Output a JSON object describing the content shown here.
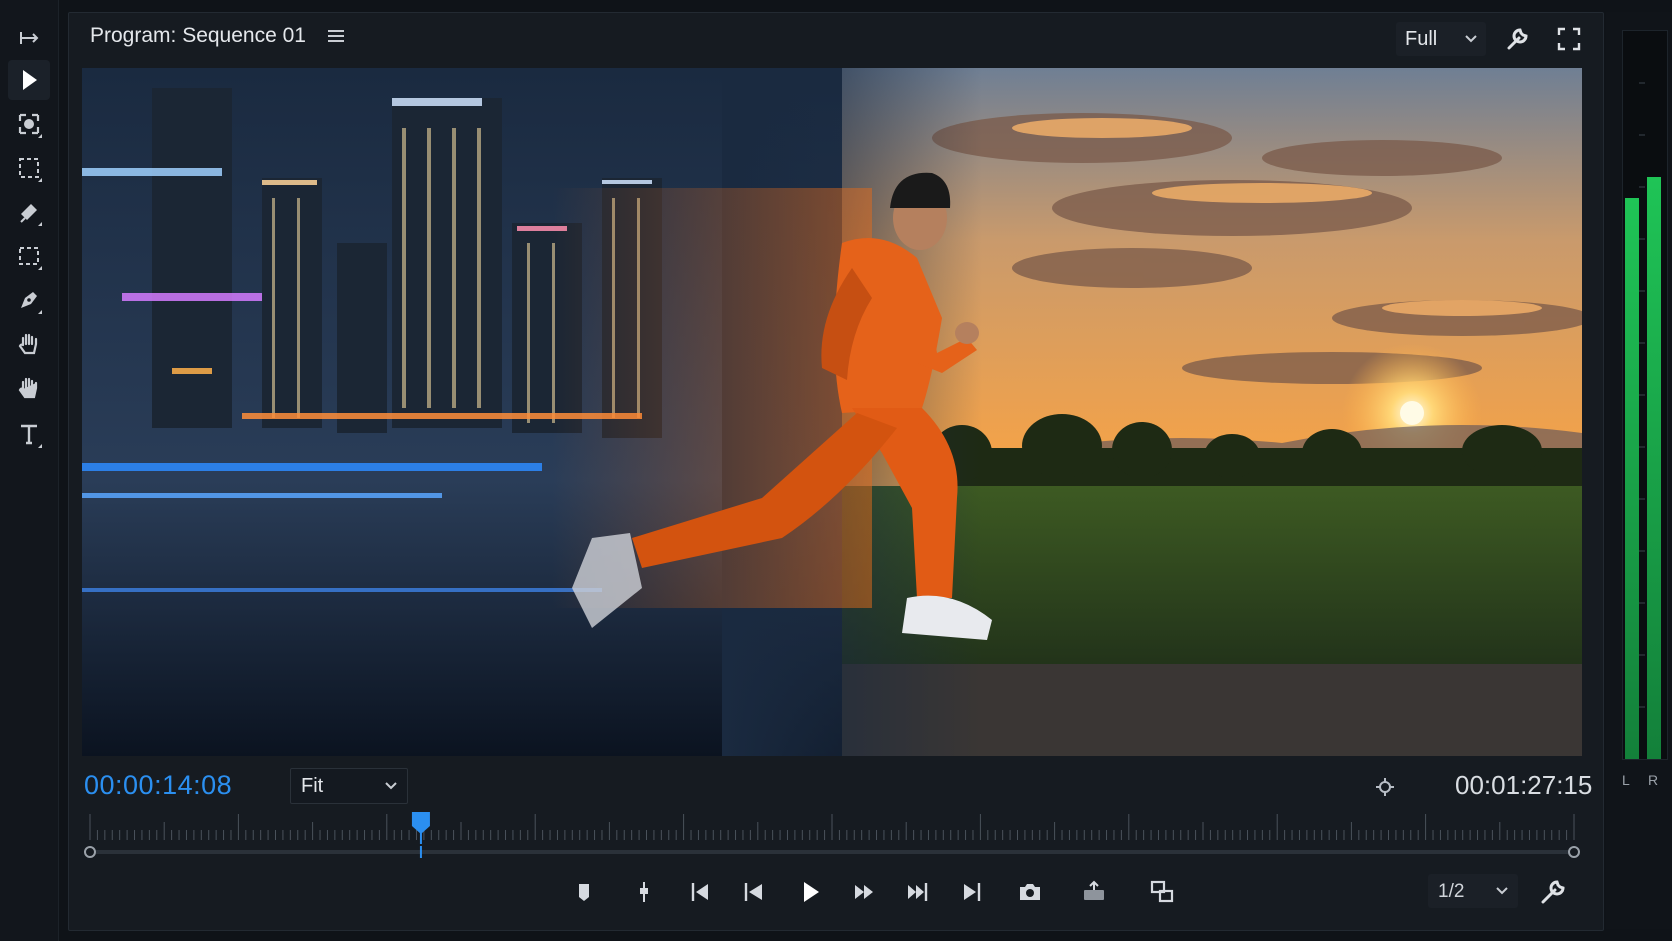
{
  "monitor": {
    "title": "Program: Sequence 01",
    "quality_label": "Full",
    "current_timecode": "00:00:14:08",
    "fit_label": "Fit",
    "duration_timecode": "00:01:27:15",
    "resolution_label": "1/2",
    "playhead_fraction": 0.223
  },
  "tools": [
    {
      "icon": "track-select-icon"
    },
    {
      "icon": "selection-arrow-icon"
    },
    {
      "icon": "ripple-edit-icon"
    },
    {
      "icon": "rolling-edit-icon"
    },
    {
      "icon": "razor-icon"
    },
    {
      "icon": "slip-icon"
    },
    {
      "icon": "pen-icon"
    },
    {
      "icon": "hand-icon"
    },
    {
      "icon": "zoom-hand-icon"
    },
    {
      "icon": "type-icon"
    }
  ],
  "transport": [
    {
      "icon": "add-marker-icon"
    },
    {
      "icon": "mark-in-out-icon"
    },
    {
      "icon": "go-to-in-icon"
    },
    {
      "icon": "step-back-icon"
    },
    {
      "icon": "play-icon"
    },
    {
      "icon": "step-forward-icon"
    },
    {
      "icon": "go-to-out-icon"
    },
    {
      "icon": "go-to-end-icon"
    },
    {
      "icon": "export-frame-icon"
    },
    {
      "icon": "lift-icon"
    },
    {
      "icon": "extract-icon"
    }
  ],
  "audio_meter": {
    "left_label": "L",
    "right_label": "R",
    "left_level": 0.77,
    "right_level": 0.8
  },
  "colors": {
    "accent": "#2b8ff0",
    "meter_green": "#1fc456"
  }
}
